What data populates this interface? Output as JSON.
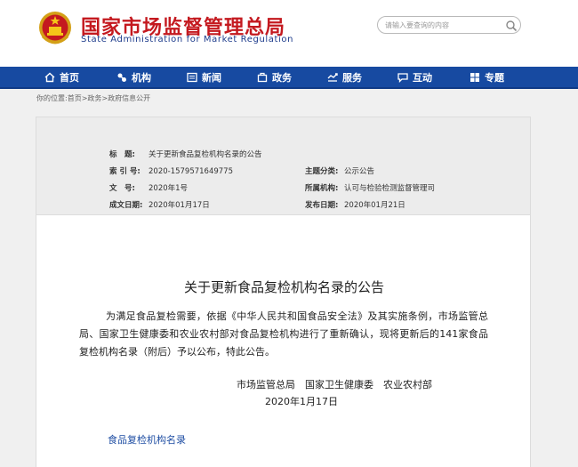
{
  "header": {
    "title": "国家市场监督管理总局",
    "subtitle": "State Administration for Market Regulation",
    "search_placeholder": "请输入要查询的内容"
  },
  "colors": {
    "brand_red": "#c4191f",
    "nav_blue": "#174aa1",
    "link_blue": "#1f4ea3"
  },
  "nav": {
    "items": [
      {
        "label": "首页",
        "icon": "home-icon"
      },
      {
        "label": "机构",
        "icon": "institution-icon"
      },
      {
        "label": "新闻",
        "icon": "news-icon"
      },
      {
        "label": "政务",
        "icon": "government-icon"
      },
      {
        "label": "服务",
        "icon": "service-icon"
      },
      {
        "label": "互动",
        "icon": "interaction-icon"
      },
      {
        "label": "专题",
        "icon": "topic-icon"
      }
    ]
  },
  "breadcrumb": "你的位置:首页>政务>政府信息公开",
  "meta": {
    "title_label": "标　题:",
    "title_value": "关于更新食品复检机构名录的公告",
    "index_label": "索 引 号:",
    "index_value": "2020-1579571649775",
    "category_label": "主题分类:",
    "category_value": "公示公告",
    "docno_label": "文　号:",
    "docno_value": "2020年1号",
    "org_label": "所属机构:",
    "org_value": "认可与检验检测监督管理司",
    "written_label": "成文日期:",
    "written_value": "2020年01月17日",
    "published_label": "发布日期:",
    "published_value": "2020年01月21日"
  },
  "article": {
    "title": "关于更新食品复检机构名录的公告",
    "body": "为满足食品复检需要，依据《中华人民共和国食品安全法》及其实施条例，市场监管总局、国家卫生健康委和农业农村部对食品复检机构进行了重新确认，现将更新后的141家食品复检机构名录（附后）予以公布，特此公告。",
    "signatories": "市场监管总局　国家卫生健康委　农业农村部",
    "date": "2020年1月17日",
    "attachment": "食品复检机构名录"
  }
}
